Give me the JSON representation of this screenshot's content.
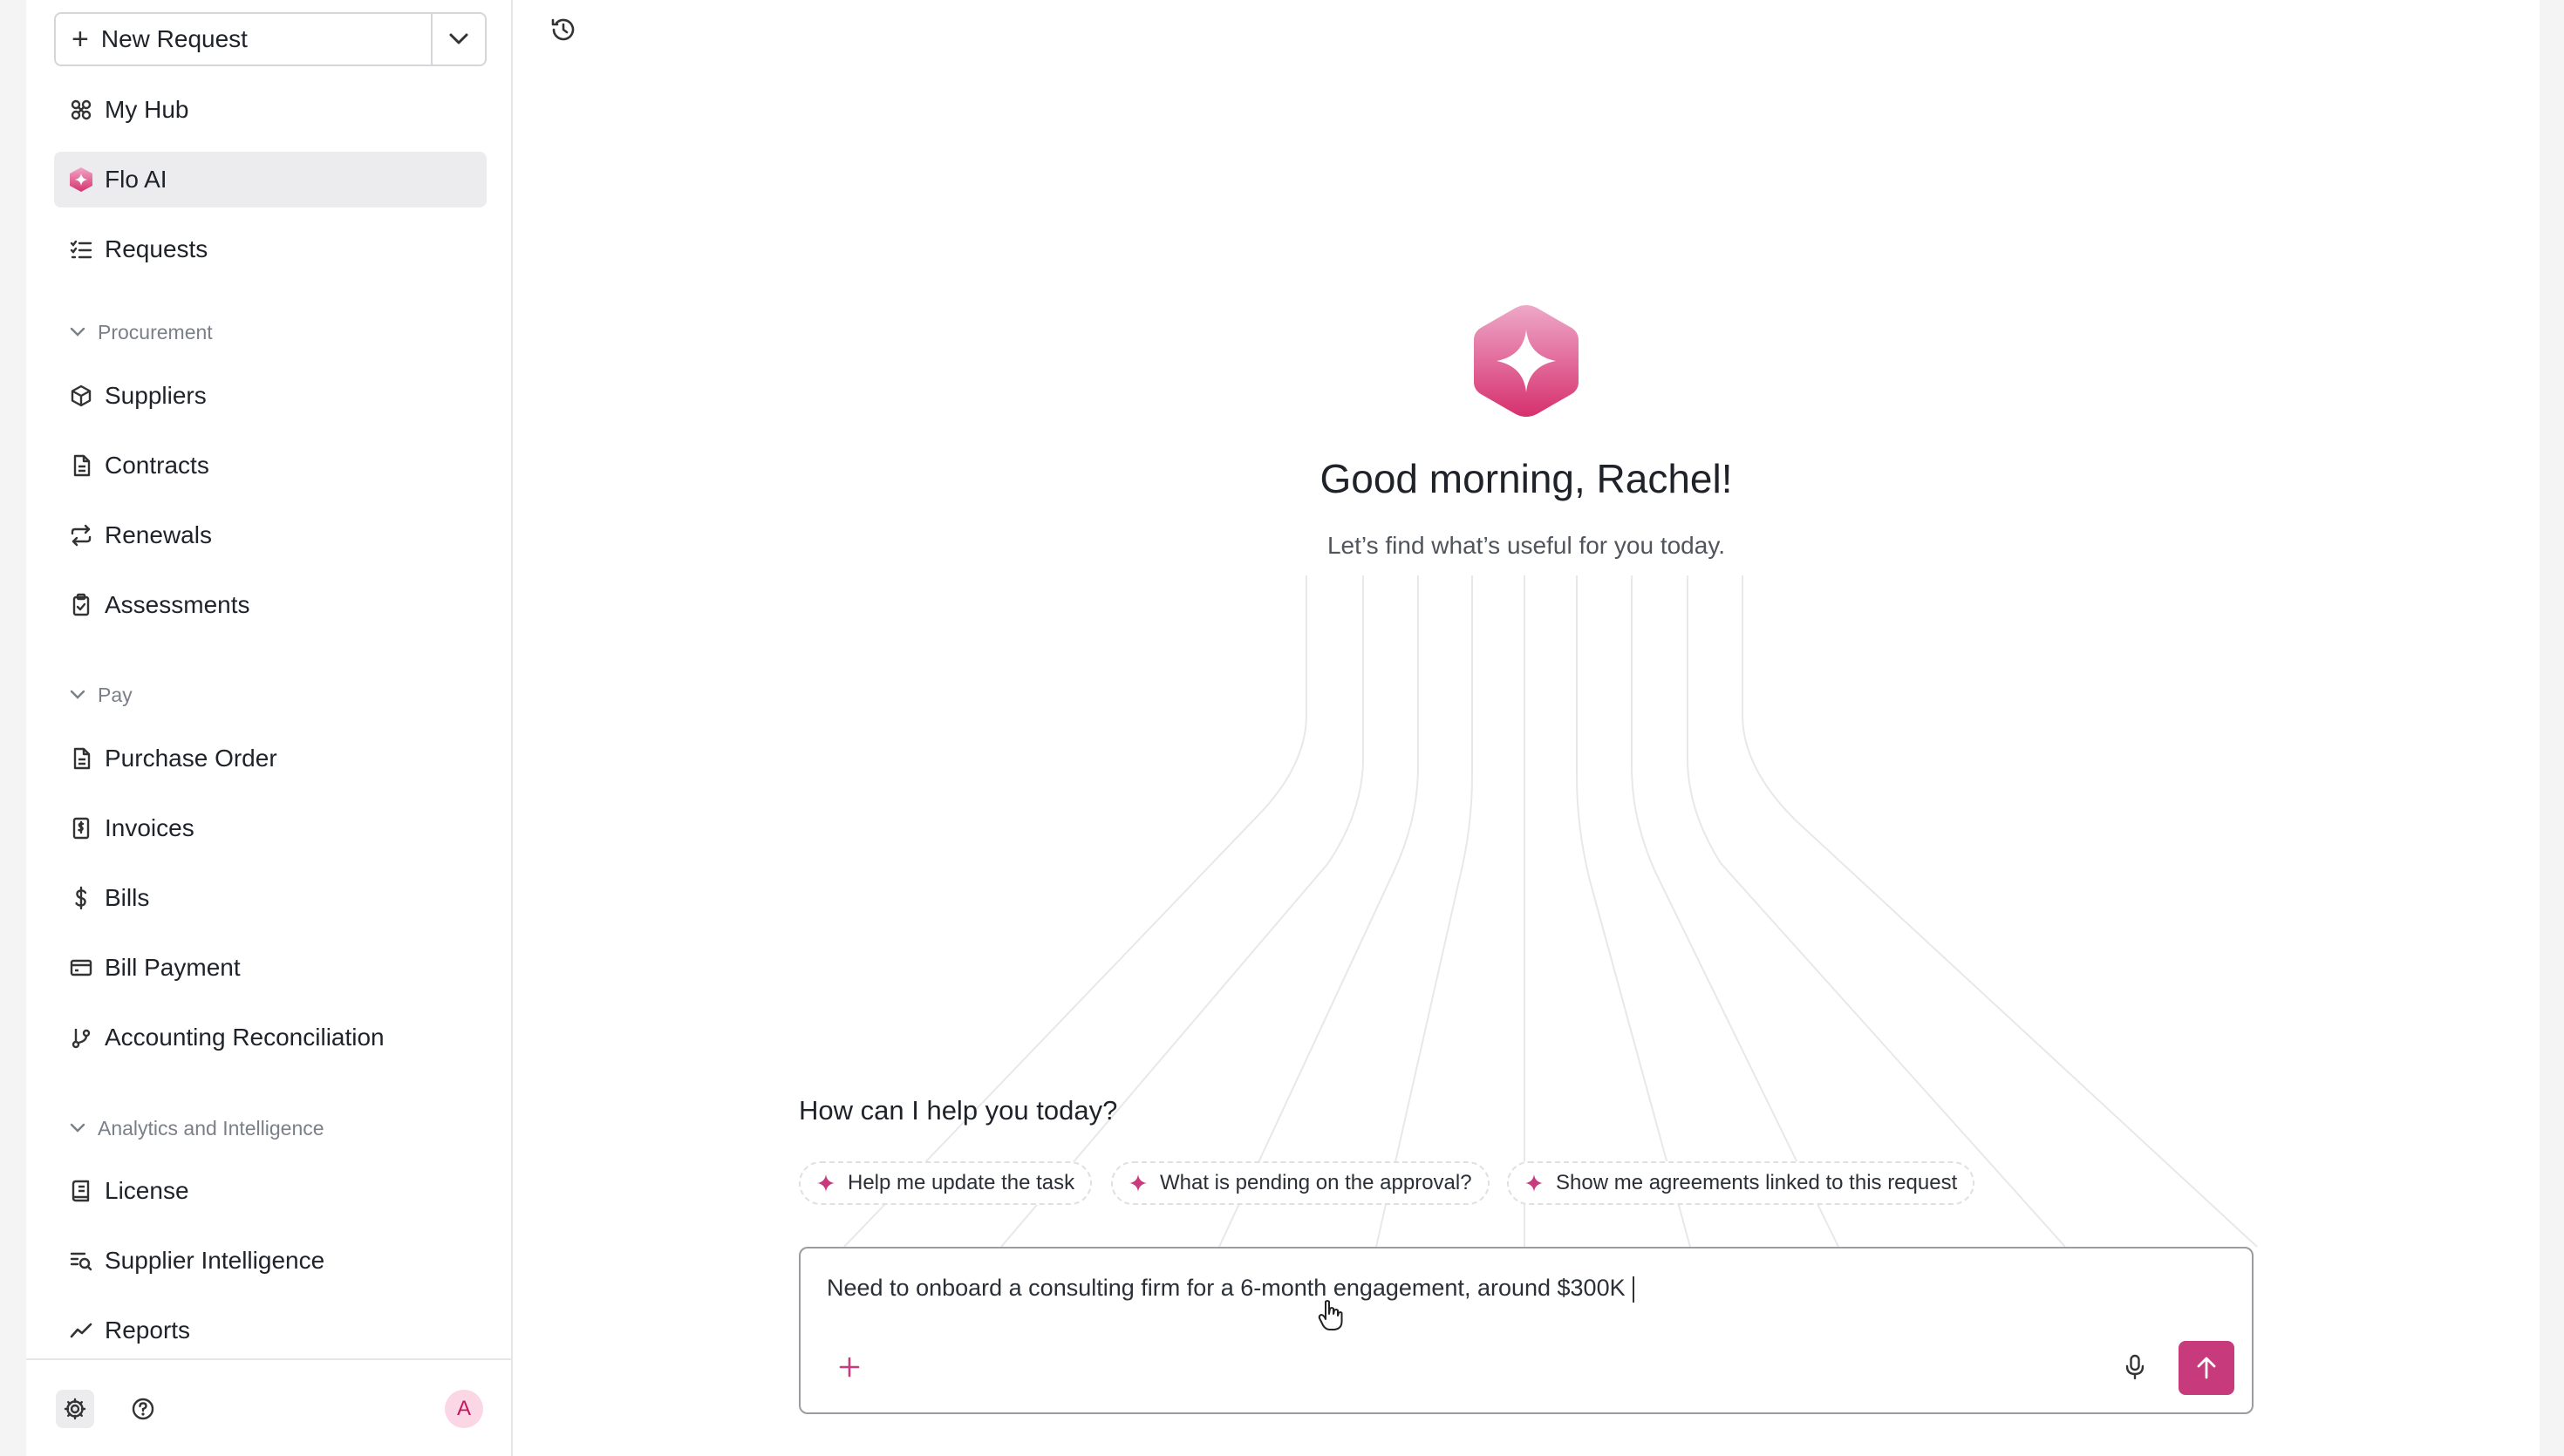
{
  "sidebar": {
    "new_request_label": "New Request",
    "items": {
      "my_hub": "My Hub",
      "flo_ai": "Flo AI",
      "requests": "Requests",
      "suppliers": "Suppliers",
      "contracts": "Contracts",
      "renewals": "Renewals",
      "assessments": "Assessments",
      "purchase_order": "Purchase Order",
      "invoices": "Invoices",
      "bills": "Bills",
      "bill_payment": "Bill Payment",
      "accounting_reconciliation": "Accounting Reconciliation",
      "license": "License",
      "supplier_intelligence": "Supplier Intelligence",
      "reports": "Reports"
    },
    "sections": {
      "procurement": "Procurement",
      "pay": "Pay",
      "analytics": "Analytics and Intelligence"
    },
    "avatar_initial": "A"
  },
  "main": {
    "greeting": "Good morning, Rachel!",
    "subgreeting": "Let’s find what’s useful for you today.",
    "help_title": "How can I help you today?",
    "suggestions": [
      "Help me update the task",
      "What is pending on the approval?",
      "Show me agreements linked to this request"
    ],
    "composer": {
      "text": "Need to onboard a consulting firm for a 6-month engagement, around $300K"
    }
  },
  "colors": {
    "accent": "#c73b7d",
    "accent_light": "#e8a1c4",
    "active_nav_bg": "#ececee"
  },
  "icons": {
    "history": "history-icon",
    "send": "arrow-up-icon",
    "mic": "microphone-icon",
    "attach": "plus-icon",
    "settings": "gear-icon",
    "help": "help-circle-icon"
  }
}
